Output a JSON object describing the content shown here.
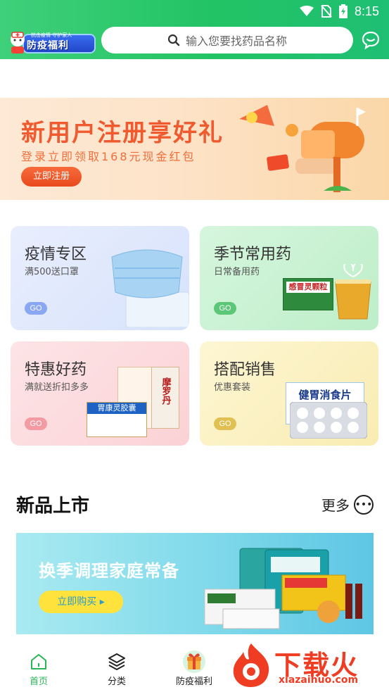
{
  "status_bar": {
    "time": "8:15"
  },
  "header": {
    "badge_small": "抗击疫情 守护家人",
    "badge_label": "防疫福利",
    "search_placeholder": "输入您要找药品名称"
  },
  "banner": {
    "title": "新用户注册享好礼",
    "subtitle": "登录立即领取168元现金红包",
    "button": "立即注册"
  },
  "categories": [
    {
      "title": "疫情专区",
      "subtitle": "满500送口罩",
      "go": "GO"
    },
    {
      "title": "季节常用药",
      "subtitle": "日常备用药",
      "go": "GO",
      "product_label": "感冒灵颗粒"
    },
    {
      "title": "特惠好药",
      "subtitle": "满就送折扣多多",
      "go": "GO",
      "product_label": "胃康灵胶囊",
      "product_label_2": "摩罗丹"
    },
    {
      "title": "搭配销售",
      "subtitle": "优惠套装",
      "go": "GO",
      "product_label": "健胃消食片"
    }
  ],
  "new_products": {
    "title": "新品上市",
    "more": "更多",
    "promo_title": "换季调理家庭常备",
    "promo_button": "立即购买 ▸"
  },
  "bottom_nav": [
    {
      "label": "首页",
      "icon": "home-icon"
    },
    {
      "label": "分类",
      "icon": "layers-icon"
    },
    {
      "label": "防疫福利",
      "icon": "gift-icon"
    }
  ],
  "watermark": {
    "text": "下载火",
    "url": "xiazaihuo.com"
  },
  "colors": {
    "brand_green": "#22c364",
    "active_nav": "#2bb657",
    "banner_orange": "#ef5a2f"
  }
}
